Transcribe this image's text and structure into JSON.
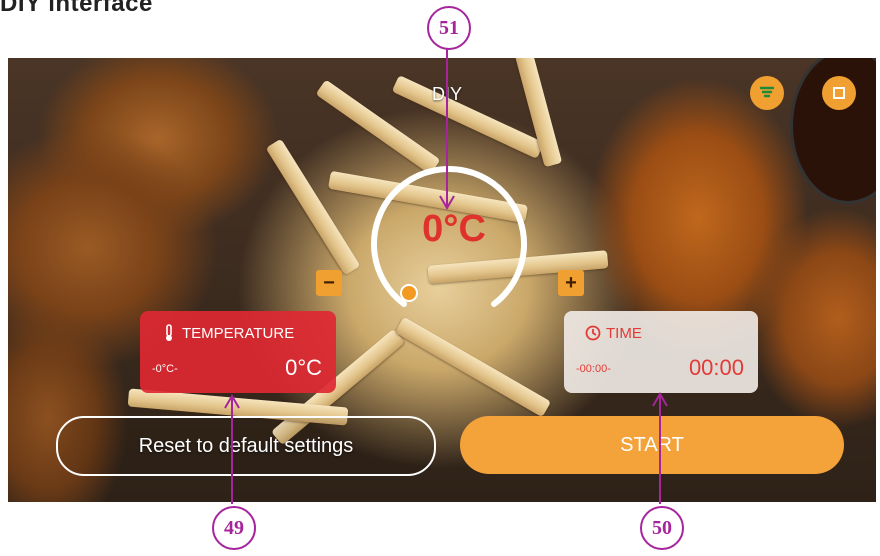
{
  "heading": "DIY interface",
  "screen": {
    "title": "DIY",
    "top_icons": [
      "fan-icon",
      "light-icon"
    ],
    "dial": {
      "value": "0°C",
      "minus": "−",
      "plus": "+"
    },
    "temperature_card": {
      "label": "TEMPERATURE",
      "icon": "thermometer-icon",
      "range": "-0°C-",
      "value": "0°C"
    },
    "time_card": {
      "label": "TIME",
      "icon": "clock-icon",
      "range": "-00:00-",
      "value": "00:00"
    },
    "reset_label": "Reset to default settings",
    "start_label": "START"
  },
  "callouts": [
    "51",
    "49",
    "50"
  ],
  "colors": {
    "accent_orange": "#f4a23a",
    "temp_red": "#de2832",
    "callout_purple": "#a6259c"
  }
}
